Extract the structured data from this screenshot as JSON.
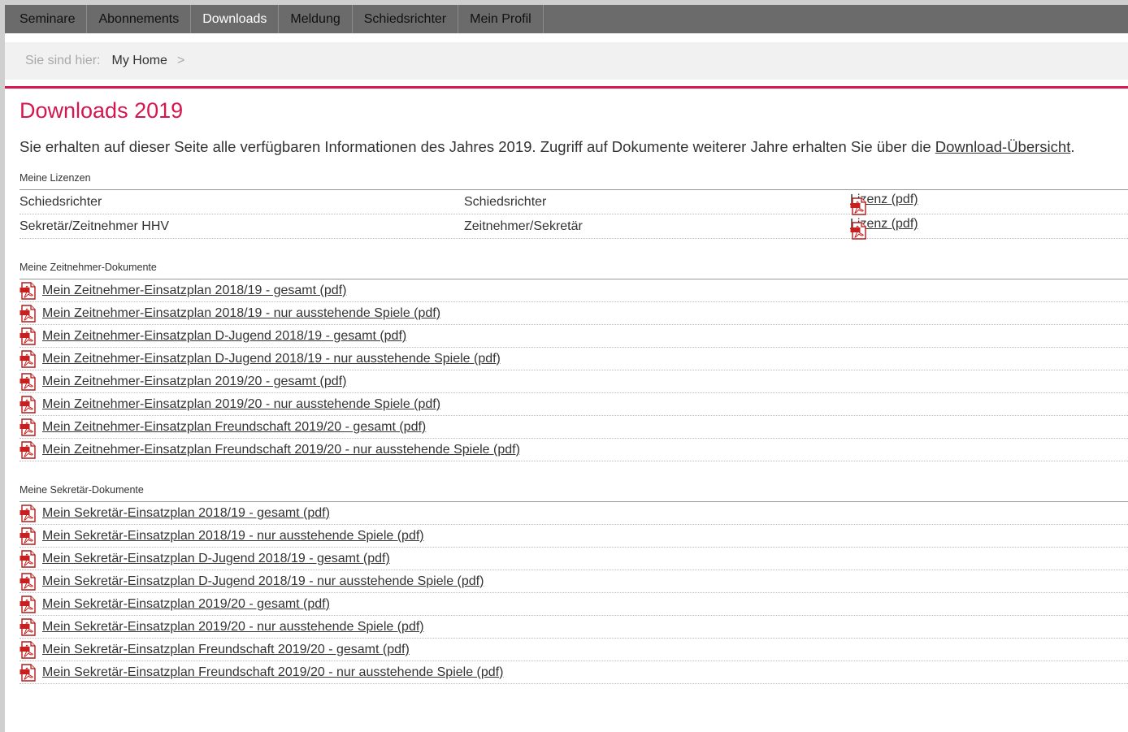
{
  "nav": {
    "tabs": [
      {
        "label": "Seminare"
      },
      {
        "label": "Abonnements"
      },
      {
        "label": "Downloads"
      },
      {
        "label": "Meldung"
      },
      {
        "label": "Schiedsrichter"
      },
      {
        "label": "Mein Profil"
      }
    ],
    "active_tab": "Downloads"
  },
  "breadcrumb": {
    "prefix": "Sie sind hier:",
    "home": "My Home",
    "separator": ">"
  },
  "page": {
    "title": "Downloads 2019",
    "intro_text": "Sie erhalten auf dieser Seite alle verfügbaren Informationen des Jahres 2019. Zugriff auf Dokumente weiterer Jahre erhalten Sie über die ",
    "intro_link": "Download-Übersicht",
    "intro_end": "."
  },
  "licenses": {
    "title": "Meine Lizenzen",
    "rows": [
      {
        "name": "Schiedsrichter",
        "type": "Schiedsrichter",
        "link": "Lizenz (pdf)"
      },
      {
        "name": "Sekretär/Zeitnehmer HHV",
        "type": "Zeitnehmer/Sekretär",
        "link": "Lizenz (pdf)"
      }
    ]
  },
  "timekeeper_docs": {
    "title": "Meine Zeitnehmer-Dokumente",
    "items": [
      "Mein Zeitnehmer-Einsatzplan 2018/19 - gesamt (pdf)",
      "Mein Zeitnehmer-Einsatzplan 2018/19 - nur ausstehende Spiele (pdf)",
      "Mein Zeitnehmer-Einsatzplan D-Jugend 2018/19 - gesamt (pdf)",
      "Mein Zeitnehmer-Einsatzplan D-Jugend 2018/19 - nur ausstehende Spiele (pdf)",
      "Mein Zeitnehmer-Einsatzplan 2019/20 - gesamt (pdf)",
      "Mein Zeitnehmer-Einsatzplan 2019/20 - nur ausstehende Spiele (pdf)",
      "Mein Zeitnehmer-Einsatzplan Freundschaft 2019/20 - gesamt (pdf)",
      "Mein Zeitnehmer-Einsatzplan Freundschaft 2019/20 - nur ausstehende Spiele (pdf)"
    ]
  },
  "secretary_docs": {
    "title": "Meine Sekretär-Dokumente",
    "items": [
      "Mein Sekretär-Einsatzplan 2018/19 - gesamt (pdf)",
      "Mein Sekretär-Einsatzplan 2018/19 - nur ausstehende Spiele (pdf)",
      "Mein Sekretär-Einsatzplan D-Jugend 2018/19 - gesamt (pdf)",
      "Mein Sekretär-Einsatzplan D-Jugend 2018/19 - nur ausstehende Spiele (pdf)",
      "Mein Sekretär-Einsatzplan 2019/20 - gesamt (pdf)",
      "Mein Sekretär-Einsatzplan 2019/20 - nur ausstehende Spiele (pdf)",
      "Mein Sekretär-Einsatzplan Freundschaft 2019/20 - gesamt (pdf)",
      "Mein Sekretär-Einsatzplan Freundschaft 2019/20 - nur ausstehende Spiele (pdf)"
    ]
  },
  "colors": {
    "accent": "#d6164e",
    "nav_bg": "#6b6b6b",
    "crumb_bg": "#f1f1f1"
  },
  "icons": {
    "document": "pdf-icon"
  }
}
